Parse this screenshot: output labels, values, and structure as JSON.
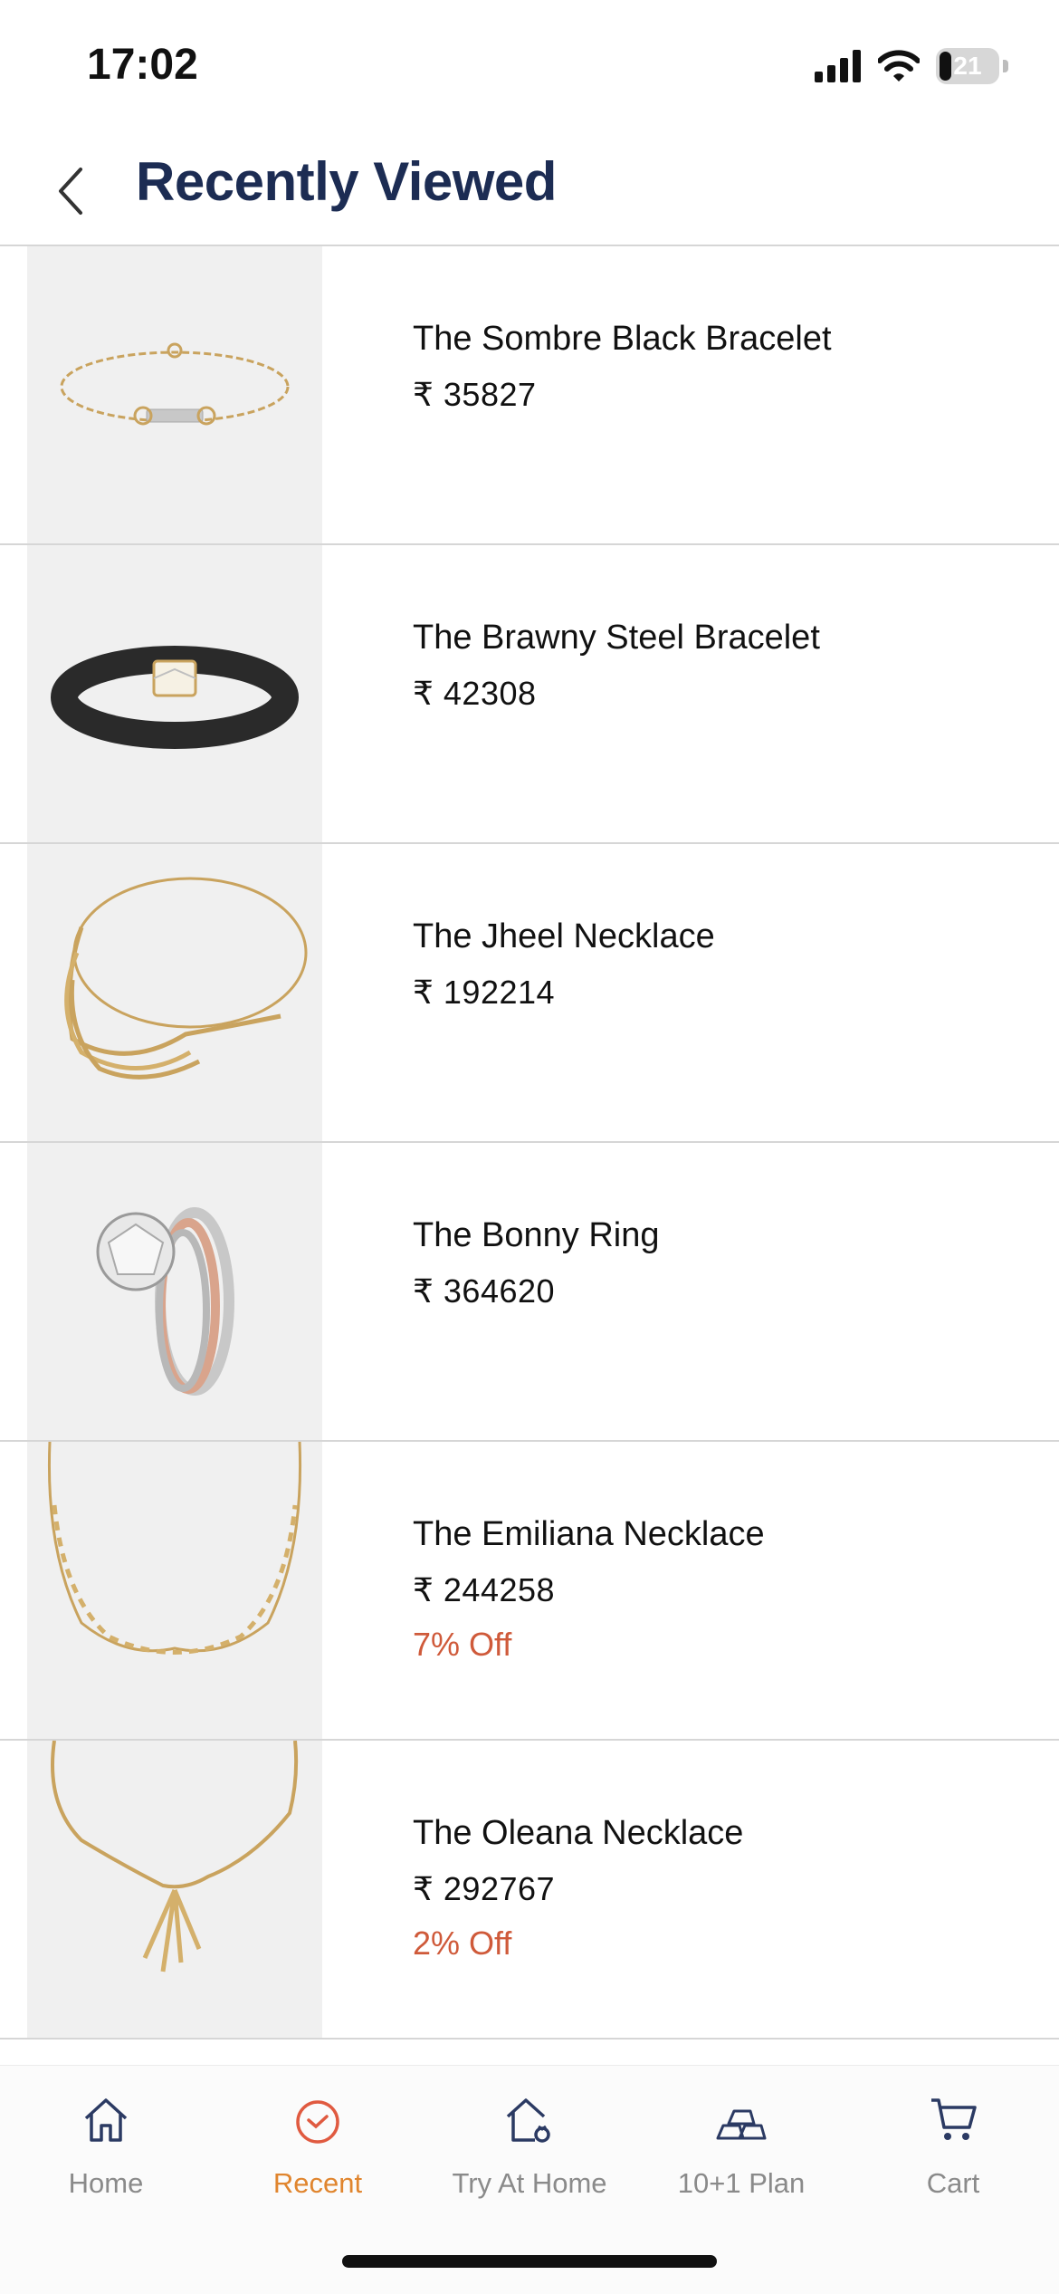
{
  "status_bar": {
    "time": "17:02",
    "battery": "21",
    "battery_fraction": 0.21
  },
  "header": {
    "title": "Recently Viewed",
    "back_icon": "chevron-left-icon"
  },
  "items": [
    {
      "name": "The Sombre Black Bracelet",
      "price": "₹ 35827",
      "discount": "",
      "image": "gold-chain-bracelet-image"
    },
    {
      "name": "The Brawny Steel Bracelet",
      "price": "₹ 42308",
      "discount": "",
      "image": "black-mesh-bracelet-image"
    },
    {
      "name": "The Jheel Necklace",
      "price": "₹ 192214",
      "discount": "",
      "image": "gold-layered-necklace-image"
    },
    {
      "name": "The Bonny Ring",
      "price": "₹ 364620",
      "discount": "",
      "image": "diamond-ring-image"
    },
    {
      "name": "The Emiliana Necklace",
      "price": "₹ 244258",
      "discount": "7% Off",
      "image": "diamond-necklace-image"
    },
    {
      "name": "The Oleana Necklace",
      "price": "₹ 292767",
      "discount": "2% Off",
      "image": "gold-drop-necklace-image"
    }
  ],
  "tabs": [
    {
      "label": "Home",
      "icon": "home-icon",
      "active": false
    },
    {
      "label": "Recent",
      "icon": "clock-icon",
      "active": true
    },
    {
      "label": "Try At Home",
      "icon": "try-at-home-icon",
      "active": false
    },
    {
      "label": "10+1 Plan",
      "icon": "gold-bars-icon",
      "active": false
    },
    {
      "label": "Cart",
      "icon": "cart-icon",
      "active": false
    }
  ],
  "colors": {
    "title": "#1c2c53",
    "active_tab": "#e0852e",
    "discount": "#cf5a3a",
    "inactive_tab": "#8a8a8a"
  }
}
